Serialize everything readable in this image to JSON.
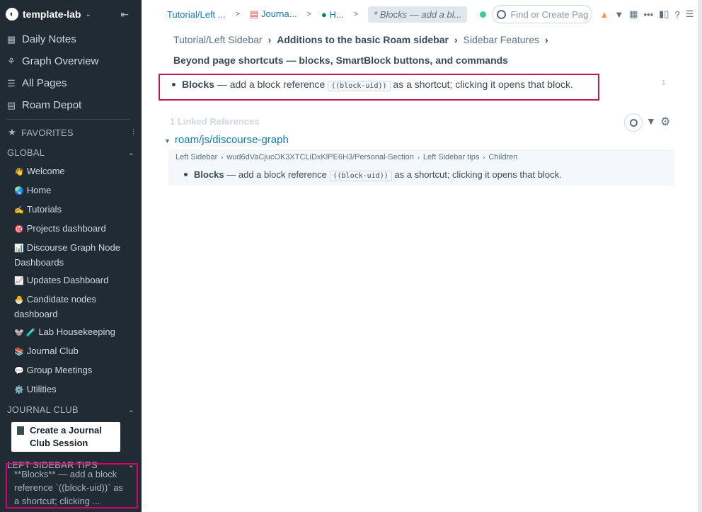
{
  "sidebar": {
    "graph_name": "template-lab",
    "nav": [
      {
        "label": "Daily Notes",
        "icon": "calendar-icon"
      },
      {
        "label": "Graph Overview",
        "icon": "graph-icon"
      },
      {
        "label": "All Pages",
        "icon": "list-icon"
      },
      {
        "label": "Roam Depot",
        "icon": "depot-icon"
      }
    ],
    "favorites_label": "FAVORITES",
    "global_label": "GLOBAL",
    "global_items": [
      {
        "emoji": "👋",
        "label": "Welcome"
      },
      {
        "emoji": "🌏",
        "label": "Home"
      },
      {
        "emoji": "✍️",
        "label": "Tutorials"
      },
      {
        "emoji": "🎯",
        "label": "Projects dashboard"
      },
      {
        "emoji": "📊",
        "label": "Discourse Graph Node Dashboards"
      },
      {
        "emoji": "📈",
        "label": "Updates Dashboard"
      },
      {
        "emoji": "🐣",
        "label": "Candidate nodes dashboard"
      },
      {
        "emoji": "🐭 🧪",
        "label": "Lab Housekeeping"
      },
      {
        "emoji": "📚",
        "label": "Journal Club"
      },
      {
        "emoji": "💬",
        "label": "Group Meetings"
      },
      {
        "emoji": "⚙️",
        "label": "Utilities"
      }
    ],
    "journal_club_label": "JOURNAL CLUB",
    "journal_button": "Create a Journal Club Session",
    "tips_label": "LEFT SIDEBAR TIPS",
    "tip_text": "**Blocks** — add a block reference `((block-uid))` as a shortcut; clicking ..."
  },
  "topbar": {
    "crumbs": [
      "Tutorial/Left ...",
      "Journa...",
      "H..."
    ],
    "active_crumb": "* Blocks — add a bl...",
    "search_placeholder": "Find or Create Pag"
  },
  "page": {
    "breadcrumb": [
      "Tutorial/Left Sidebar",
      "Additions to the basic Roam sidebar",
      "Sidebar Features"
    ],
    "title": "Beyond page shortcuts — blocks, SmartBlock buttons, and commands",
    "block": {
      "bold": "Blocks",
      "pre": " — add a block reference ",
      "code": "((block-uid))",
      "post": " as a shortcut; clicking it opens that block.",
      "count": "1"
    },
    "linked_refs_title": "1 Linked References",
    "ref_page": "roam/js/discourse-graph",
    "ref_breadcrumb": [
      "Left Sidebar",
      "wud6dVaCjucOK3XTCLiDxKlPE6H3/Personal-Section",
      "Left Sidebar tips",
      "Children"
    ]
  },
  "colors": {
    "sidebar_bg": "#202b33",
    "link": "#137cbd",
    "highlight_border": "#d6006e"
  }
}
